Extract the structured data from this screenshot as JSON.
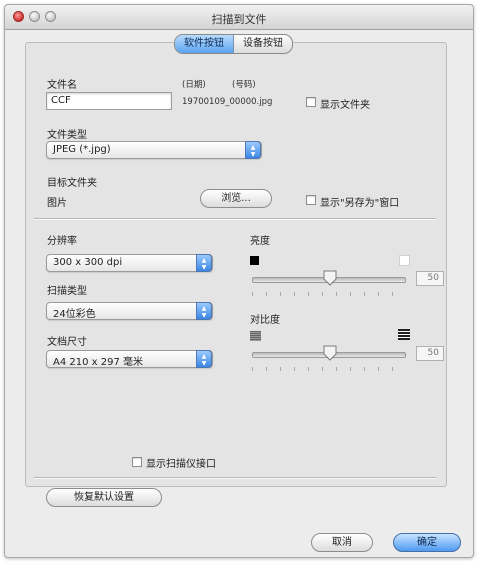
{
  "window": {
    "title": "扫描到文件"
  },
  "tabs": [
    {
      "label": "软件按钮",
      "active": true
    },
    {
      "label": "设备按钮",
      "active": false
    }
  ],
  "file": {
    "name_label": "文件名",
    "name_value": "CCF",
    "date_label": "(日期)",
    "number_label": "(号码)",
    "filename_preview": "19700109_00000.jpg",
    "show_folder_label": "显示文件夹",
    "show_folder_checked": false,
    "type_label": "文件类型",
    "type_value": "JPEG (*.jpg)",
    "dest_label": "目标文件夹",
    "dest_value": "图片",
    "browse_label": "浏览...",
    "show_saveas_label": "显示\"另存为\"窗口",
    "show_saveas_checked": false
  },
  "scan": {
    "resolution_label": "分辨率",
    "resolution_value": "300 x 300 dpi",
    "scan_type_label": "扫描类型",
    "scan_type_value": "24位彩色",
    "doc_size_label": "文档尺寸",
    "doc_size_value": "A4  210 x 297 毫米",
    "brightness_label": "亮度",
    "brightness_value": "50",
    "contrast_label": "对比度",
    "contrast_value": "50",
    "show_scanner_ui_label": "显示扫描仪接口",
    "show_scanner_ui_checked": false
  },
  "buttons": {
    "restore_defaults": "恢复默认设置",
    "cancel": "取消",
    "ok": "确定"
  },
  "colors": {
    "accent": "#4f9af0",
    "window_bg": "#ececec",
    "close_button": "#d0312d"
  },
  "icons": {
    "popup_arrows": "up-down-chevron-icon",
    "brightness_low": "black-square-icon",
    "brightness_high": "white-square-icon",
    "contrast_low": "low-contrast-icon",
    "contrast_high": "high-contrast-icon"
  }
}
